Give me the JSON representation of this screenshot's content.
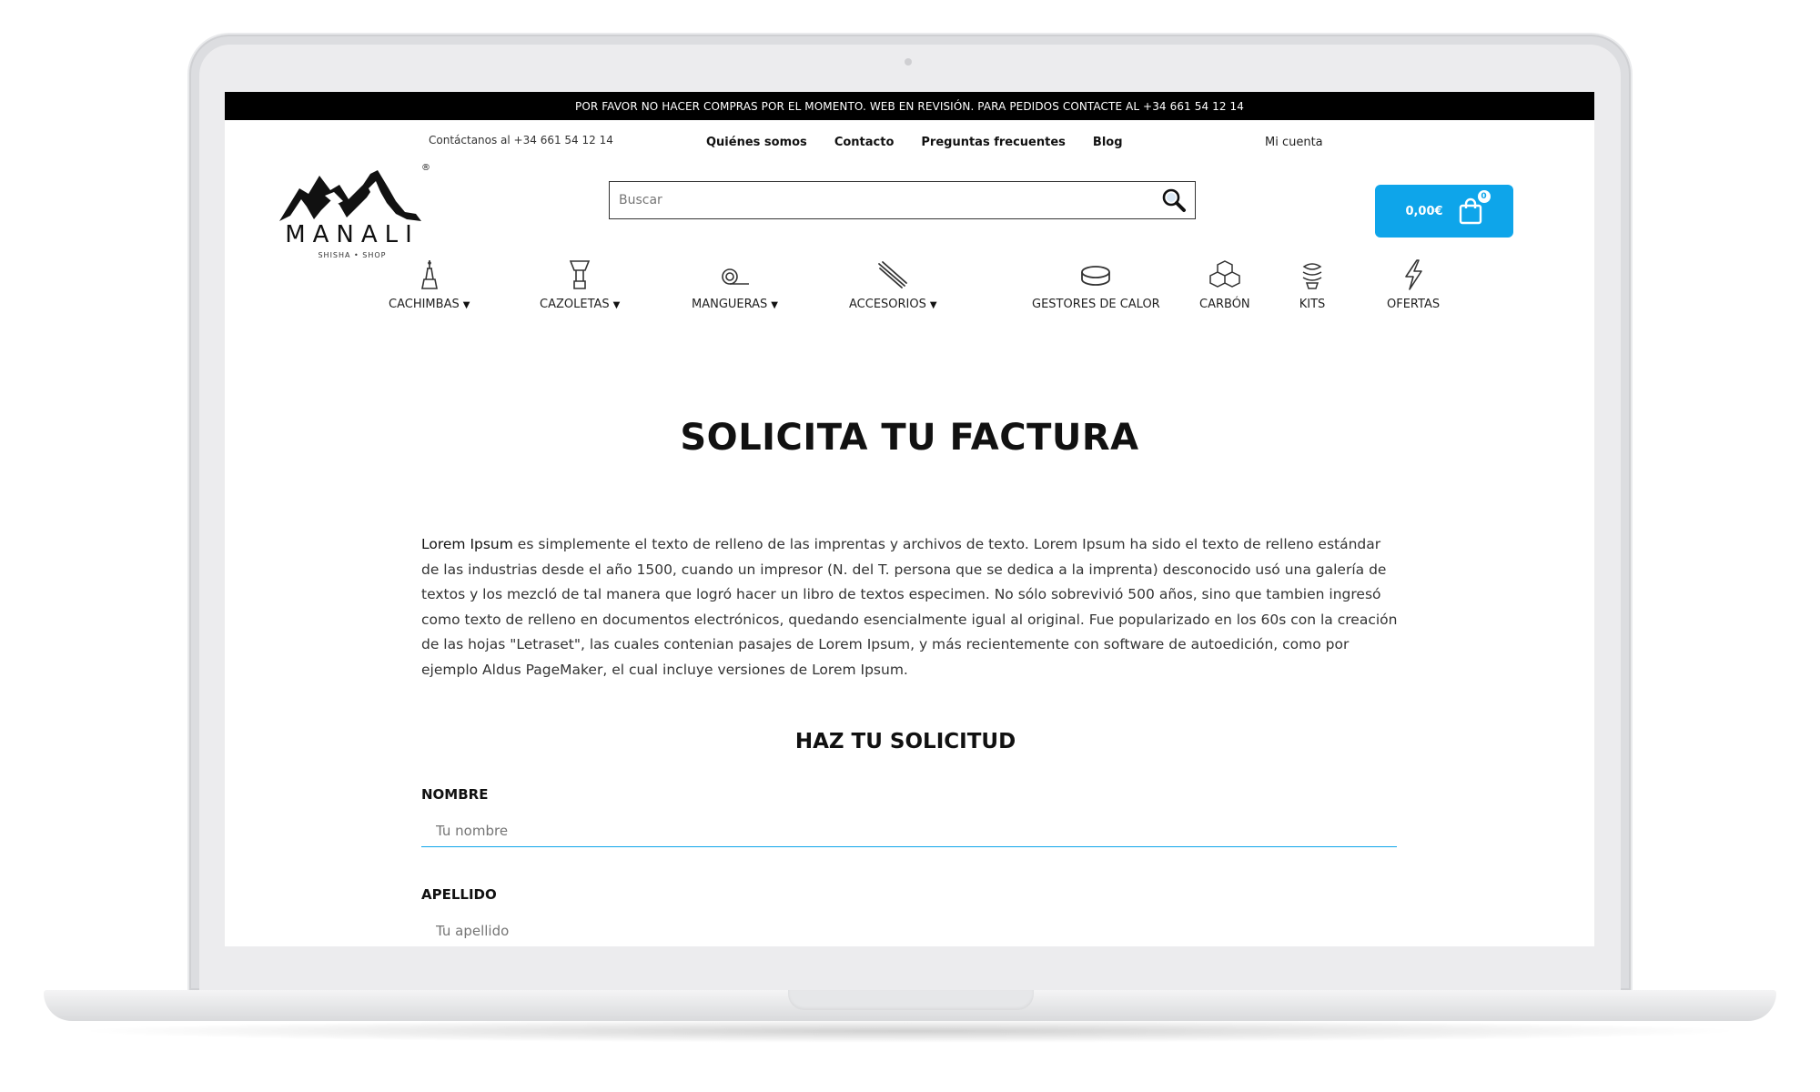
{
  "announcement": "POR FAVOR NO HACER COMPRAS POR EL MOMENTO. WEB EN REVISIÓN. PARA PEDIDOS CONTACTE AL +34 661 54 12 14",
  "header": {
    "contact_text": "Contáctanos al +34 661 54 12 14",
    "nav": [
      "Quiénes somos",
      "Contacto",
      "Preguntas frecuentes",
      "Blog"
    ],
    "account": "Mi cuenta",
    "logo": {
      "brand": "MANALI",
      "sub": "SHISHA • SHOP",
      "reg": "®"
    },
    "search": {
      "placeholder": "Buscar",
      "icon": "search-icon"
    },
    "cart": {
      "total": "0,00€",
      "count": "0",
      "icon": "shopping-bag-icon",
      "color": "#0ea5ea"
    }
  },
  "categories": [
    {
      "label": "CACHIMBAS",
      "has_dropdown": true,
      "icon": "hookah-icon"
    },
    {
      "label": "CAZOLETAS",
      "has_dropdown": true,
      "icon": "bowl-icon"
    },
    {
      "label": "MANGUERAS",
      "has_dropdown": true,
      "icon": "hose-icon"
    },
    {
      "label": "ACCESORIOS",
      "has_dropdown": true,
      "icon": "tongs-icon"
    },
    {
      "label": "GESTORES DE CALOR",
      "has_dropdown": false,
      "icon": "heat-manager-icon"
    },
    {
      "label": "CARBÓN",
      "has_dropdown": false,
      "icon": "charcoal-cubes-icon"
    },
    {
      "label": "KITS",
      "has_dropdown": false,
      "icon": "kit-icon"
    },
    {
      "label": "OFERTAS",
      "has_dropdown": false,
      "icon": "lightning-icon"
    }
  ],
  "main": {
    "title": "SOLICITA TU FACTURA",
    "paragraph_lead": "Lorem Ipsum",
    "paragraph_rest": " es simplemente el texto de relleno de las imprentas y archivos de texto. Lorem Ipsum ha sido el texto de relleno estándar de las industrias desde el año 1500, cuando un impresor (N. del T. persona que se dedica a la imprenta) desconocido usó una galería de textos y los mezcló de tal manera que logró hacer un libro de textos especimen. No sólo sobrevivió 500 años, sino que tambien ingresó como texto de relleno en documentos electrónicos, quedando esencialmente igual al original. Fue popularizado en los 60s con la creación de las hojas \"Letraset\", las cuales contenian pasajes de Lorem Ipsum, y más recientemente con software de autoedición, como por ejemplo Aldus PageMaker, el cual incluye versiones de Lorem Ipsum.",
    "form_title": "HAZ TU SOLICITUD",
    "fields": [
      {
        "label": "NOMBRE",
        "placeholder": "Tu nombre"
      },
      {
        "label": "APELLIDO",
        "placeholder": "Tu apellido"
      }
    ]
  }
}
